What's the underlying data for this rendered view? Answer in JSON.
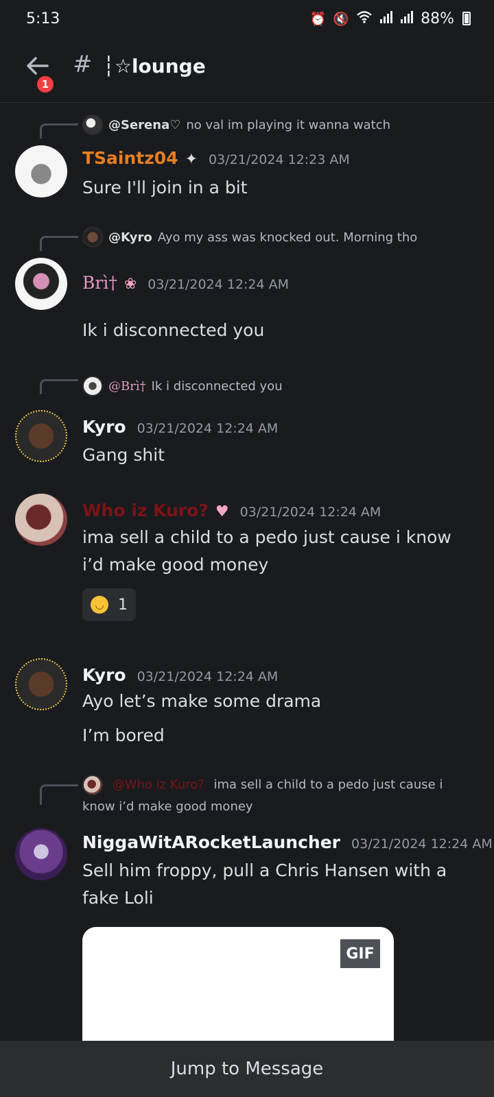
{
  "status_bar": {
    "time": "5:13",
    "battery": "88%",
    "icons": [
      "alarm-icon",
      "mute-icon",
      "wifi-icon",
      "signal-icon",
      "signal-icon",
      "battery-icon"
    ]
  },
  "header": {
    "badge_count": "1",
    "hash": "#",
    "channel_name": "┆☆lounge"
  },
  "messages": [
    {
      "reply": {
        "user": "@Serena♡",
        "text": "no val im playing it wanna watch"
      },
      "author": "TSaintz04",
      "author_color": "#e67e22",
      "deco": "✦",
      "timestamp": "03/21/2024 12:23 AM",
      "lines": [
        "Sure I'll join in a bit"
      ]
    },
    {
      "reply": {
        "user": "@Kyro",
        "text": "Ayo my ass was knocked out. Morning tho"
      },
      "author": "Brì†",
      "author_color": "#e49ac7",
      "deco": "❀",
      "timestamp": "03/21/2024 12:24 AM",
      "lines": [
        "Ik i disconnected you"
      ]
    },
    {
      "reply": {
        "user": "@Brì†",
        "user_color": "#e49ac7",
        "text": "Ik i disconnected you"
      },
      "author": "Kyro",
      "author_color": "#f2f3f5",
      "timestamp": "03/21/2024 12:24 AM",
      "lines": [
        "Gang shit"
      ]
    },
    {
      "author": "Who iz Kuro?",
      "author_color": "#7a1416",
      "deco": "♥",
      "timestamp": "03/21/2024 12:24 AM",
      "lines": [
        "ima sell a child to a pedo just cause i know i’d make good money"
      ],
      "reaction": {
        "emoji": "smirk-emoji",
        "count": "1"
      }
    },
    {
      "author": "Kyro",
      "author_color": "#f2f3f5",
      "timestamp": "03/21/2024 12:24 AM",
      "lines": [
        "Ayo let’s make some drama",
        "I’m bored"
      ]
    },
    {
      "reply": {
        "user": "@Who iz Kuro?",
        "user_color": "#7a1416",
        "text": "ima sell a child to a pedo just cause i know i’d make good money"
      },
      "author": "NiggaWitARocketLauncher",
      "author_color": "#f2f3f5",
      "timestamp": "03/21/2024 12:24 AM",
      "lines": [
        "Sell him froppy, pull a Chris Hansen with a fake Loli"
      ],
      "gif_label": "GIF"
    }
  ],
  "jump_bar": {
    "label": "Jump to Message"
  }
}
